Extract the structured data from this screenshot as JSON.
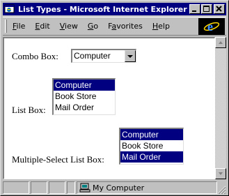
{
  "window": {
    "title": "List Types - Microsoft Internet Explorer",
    "controls": {
      "minimize": "_",
      "maximize": "□",
      "close": "×"
    }
  },
  "menubar": {
    "items": [
      {
        "label": "File",
        "accel": "F",
        "rest": "ile"
      },
      {
        "label": "Edit",
        "accel": "E",
        "rest": "dit"
      },
      {
        "label": "View",
        "accel": "V",
        "rest": "iew"
      },
      {
        "label": "Go",
        "accel": "G",
        "rest": "o"
      },
      {
        "label": "Favorites",
        "accel": "a",
        "pre": "F",
        "rest": "vorites"
      },
      {
        "label": "Help",
        "accel": "H",
        "rest": "elp"
      }
    ],
    "logo_icon": "ie-logo"
  },
  "page": {
    "combo": {
      "label": "Combo Box:",
      "value": "Computer"
    },
    "listbox": {
      "label": "List Box:",
      "options": [
        "Computer",
        "Book Store",
        "Mail Order"
      ],
      "selected": [
        0
      ]
    },
    "multiselect": {
      "label": "Multiple-Select List Box:",
      "options": [
        "Computer",
        "Book Store",
        "Mail Order"
      ],
      "selected": [
        0,
        2
      ]
    }
  },
  "statusbar": {
    "zone": "My Computer",
    "zone_icon": "computer-icon"
  },
  "colors": {
    "titlebar": "#000080",
    "selection": "#000080",
    "face": "#c0c0c0"
  }
}
